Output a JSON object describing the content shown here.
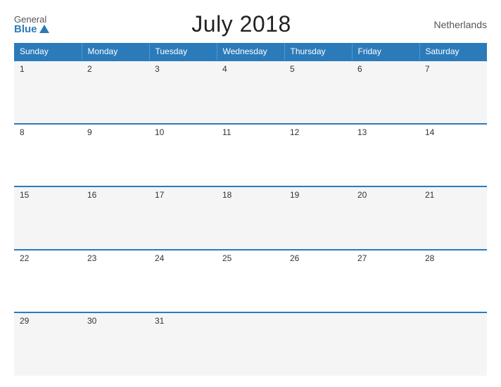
{
  "header": {
    "logo_general": "General",
    "logo_blue": "Blue",
    "title": "July 2018",
    "country": "Netherlands"
  },
  "weekdays": [
    "Sunday",
    "Monday",
    "Tuesday",
    "Wednesday",
    "Thursday",
    "Friday",
    "Saturday"
  ],
  "weeks": [
    [
      {
        "day": 1
      },
      {
        "day": 2
      },
      {
        "day": 3
      },
      {
        "day": 4
      },
      {
        "day": 5
      },
      {
        "day": 6
      },
      {
        "day": 7
      }
    ],
    [
      {
        "day": 8
      },
      {
        "day": 9
      },
      {
        "day": 10
      },
      {
        "day": 11
      },
      {
        "day": 12
      },
      {
        "day": 13
      },
      {
        "day": 14
      }
    ],
    [
      {
        "day": 15
      },
      {
        "day": 16
      },
      {
        "day": 17
      },
      {
        "day": 18
      },
      {
        "day": 19
      },
      {
        "day": 20
      },
      {
        "day": 21
      }
    ],
    [
      {
        "day": 22
      },
      {
        "day": 23
      },
      {
        "day": 24
      },
      {
        "day": 25
      },
      {
        "day": 26
      },
      {
        "day": 27
      },
      {
        "day": 28
      }
    ],
    [
      {
        "day": 29
      },
      {
        "day": 30
      },
      {
        "day": 31
      },
      {
        "day": null
      },
      {
        "day": null
      },
      {
        "day": null
      },
      {
        "day": null
      }
    ]
  ]
}
